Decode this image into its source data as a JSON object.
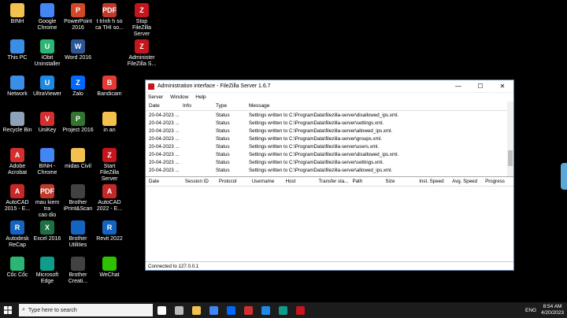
{
  "desktop": {
    "icons": [
      {
        "label": "BINH",
        "color": "#f2c14e",
        "glyph": ""
      },
      {
        "label": "Google\nChrome",
        "color": "#4285f4",
        "glyph": ""
      },
      {
        "label": "PowerPoint\n2016",
        "color": "#d24726",
        "glyph": "P"
      },
      {
        "label": "t trình h so\nca THI so...",
        "color": "#c0392b",
        "glyph": "PDF"
      },
      {
        "label": "Stop FileZilla\nServer",
        "color": "#c4161c",
        "glyph": "Z"
      },
      {
        "label": "This PC",
        "color": "#3a8ee6",
        "glyph": ""
      },
      {
        "label": "IObit\nUninstaller",
        "color": "#2bb673",
        "glyph": "U"
      },
      {
        "label": "Word 2016",
        "color": "#2b5797",
        "glyph": "W"
      },
      {
        "label": "Administer\nFileZilla S...",
        "color": "#c4161c",
        "glyph": "Z"
      },
      {
        "label": "Network",
        "color": "#3a8ee6",
        "glyph": ""
      },
      {
        "label": "UltraViewer",
        "color": "#1e88e5",
        "glyph": "U"
      },
      {
        "label": "Zalo",
        "color": "#0068ff",
        "glyph": "Z"
      },
      {
        "label": "Bandicam",
        "color": "#e53935",
        "glyph": "B"
      },
      {
        "label": "Recycle Bin",
        "color": "#8fa3b8",
        "glyph": ""
      },
      {
        "label": "UniKey",
        "color": "#d32f2f",
        "glyph": "V"
      },
      {
        "label": "Project 2016",
        "color": "#31752f",
        "glyph": "P"
      },
      {
        "label": "in an",
        "color": "#f2c14e",
        "glyph": ""
      },
      {
        "label": "Adobe\nAcrobat",
        "color": "#d32f2f",
        "glyph": "A"
      },
      {
        "label": "BINH -\nChrome",
        "color": "#4285f4",
        "glyph": ""
      },
      {
        "label": "midas Civil",
        "color": "#f2c14e",
        "glyph": ""
      },
      {
        "label": "Start FileZilla\nServer",
        "color": "#c4161c",
        "glyph": "Z"
      },
      {
        "label": "AutoCAD\n2015 - E...",
        "color": "#c62828",
        "glyph": "A"
      },
      {
        "label": "mau kiem tra\ncao dio",
        "color": "#c0392b",
        "glyph": "PDF"
      },
      {
        "label": "Brother\niPrint&Scan",
        "color": "#424242",
        "glyph": ""
      },
      {
        "label": "AutoCAD\n2022 - E...",
        "color": "#c62828",
        "glyph": "A"
      },
      {
        "label": "Autodesk\nReCap",
        "color": "#1565c0",
        "glyph": "R"
      },
      {
        "label": "Excel 2016",
        "color": "#1e7145",
        "glyph": "X"
      },
      {
        "label": "Brother\nUtilities",
        "color": "#1565c0",
        "glyph": ""
      },
      {
        "label": "Revit 2022",
        "color": "#1565c0",
        "glyph": "R"
      },
      {
        "label": "Cốc Cốc",
        "color": "#2bb673",
        "glyph": ""
      },
      {
        "label": "Microsoft\nEdge",
        "color": "#0f9d8a",
        "glyph": ""
      },
      {
        "label": "Brother\nCreati...",
        "color": "#424242",
        "glyph": ""
      },
      {
        "label": "WeChat",
        "color": "#2dc100",
        "glyph": ""
      }
    ]
  },
  "window": {
    "title": "Administration interface - FileZilla Server 1.6.7",
    "controls": {
      "minimize": "—",
      "maximize": "☐",
      "close": "✕"
    },
    "menu": [
      "Server",
      "Window",
      "Help"
    ],
    "log_headers": [
      "Date",
      "Info",
      "Type",
      "Message"
    ],
    "log_rows": [
      {
        "date": "20-04-2023 ...",
        "info": "",
        "type": "Status",
        "message": "Settings written to C:\\ProgramData\\filezilla-server\\disallowed_ips.xml."
      },
      {
        "date": "20-04-2023 ...",
        "info": "",
        "type": "Status",
        "message": "Settings written to C:\\ProgramData\\filezilla-server\\settings.xml."
      },
      {
        "date": "20-04-2023 ...",
        "info": "",
        "type": "Status",
        "message": "Settings written to C:\\ProgramData\\filezilla-server\\allowed_ips.xml."
      },
      {
        "date": "20-04-2023 ...",
        "info": "",
        "type": "Status",
        "message": "Settings written to C:\\ProgramData\\filezilla-server\\groups.xml."
      },
      {
        "date": "20-04-2023 ...",
        "info": "",
        "type": "Status",
        "message": "Settings written to C:\\ProgramData\\filezilla-server\\users.xml."
      },
      {
        "date": "20-04-2023 ...",
        "info": "",
        "type": "Status",
        "message": "Settings written to C:\\ProgramData\\filezilla-server\\disallowed_ips.xml."
      },
      {
        "date": "20-04-2023 ...",
        "info": "",
        "type": "Status",
        "message": "Settings written to C:\\ProgramData\\filezilla-server\\settings.xml."
      },
      {
        "date": "20-04-2023 ...",
        "info": "",
        "type": "Status",
        "message": "Settings written to C:\\ProgramData\\filezilla-server\\allowed_ips.xml."
      }
    ],
    "transfer_headers": [
      "Date",
      "Session ID",
      "Protocol",
      "Username",
      "Host",
      "Transfer sta...",
      "Path",
      "Size",
      "Inst. Speed",
      "Avg. Speed",
      "Progress"
    ],
    "status": "Connected to 127.0.0.1"
  },
  "taskbar": {
    "search_placeholder": "Type here to search",
    "apps": [
      {
        "name": "task-view",
        "color": "#ffffff"
      },
      {
        "name": "widgets",
        "color": "#bbbbbb"
      },
      {
        "name": "file-explorer",
        "color": "#f2c14e"
      },
      {
        "name": "chrome",
        "color": "#4285f4"
      },
      {
        "name": "zalo",
        "color": "#0068ff"
      },
      {
        "name": "acrobat-pdf",
        "color": "#d32f2f"
      },
      {
        "name": "ultraviewer",
        "color": "#1e88e5"
      },
      {
        "name": "edge",
        "color": "#0f9d8a"
      },
      {
        "name": "filezilla",
        "color": "#c4161c"
      }
    ],
    "tray": {
      "lang": "ENG",
      "time": "8:54 AM",
      "date": "4/20/2023"
    }
  }
}
